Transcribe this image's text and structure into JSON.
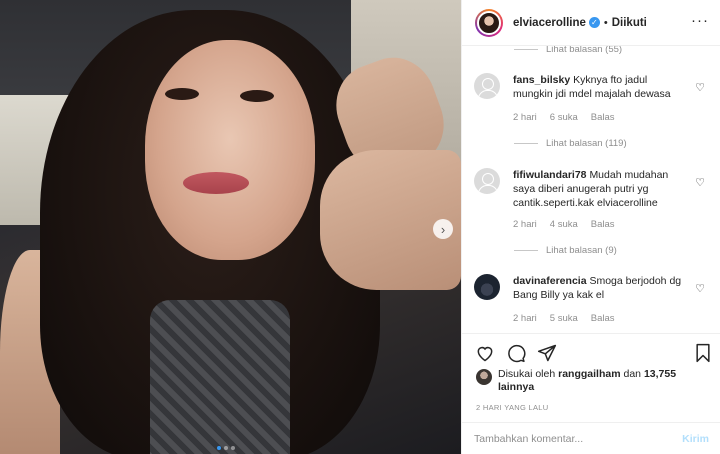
{
  "header": {
    "username": "elviacerolline",
    "separator": "•",
    "follow_status": "Diikuti",
    "more_icon": "ellipsis-icon"
  },
  "comments": {
    "top_replies": "Lihat balasan (55)",
    "items": [
      {
        "username": "fans_bilsky",
        "text": "Kyknya fto jadul mungkin jdi mdel majalah dewasa",
        "time": "2 hari",
        "likes": "6 suka",
        "reply": "Balas",
        "view_replies": "Lihat balasan (119)"
      },
      {
        "username": "fifiwulandari78",
        "text": "Mudah mudahan saya diberi anugerah putri yg cantik.seperti.kak elviacerolline",
        "time": "2 hari",
        "likes": "4 suka",
        "reply": "Balas",
        "view_replies": "Lihat balasan (9)"
      },
      {
        "username": "davinaferencia",
        "text": "Smoga berjodoh dg Bang Billy ya kak el",
        "time": "2 hari",
        "likes": "5 suka",
        "reply": "Balas"
      }
    ]
  },
  "likes": {
    "prefix": "Disukai oleh",
    "user": "ranggailham",
    "connector": "dan",
    "count": "13,755 lainnya"
  },
  "post_date": "2 HARI YANG LALU",
  "add_comment": {
    "placeholder": "Tambahkan komentar...",
    "post_label": "Kirim"
  },
  "carousel": {
    "next_icon": "chevron-right-icon",
    "dots": 3,
    "active_dot": 1
  },
  "colors": {
    "accent": "#3897f0",
    "muted": "#8e8e8e",
    "post_disabled": "#b2dffc"
  }
}
